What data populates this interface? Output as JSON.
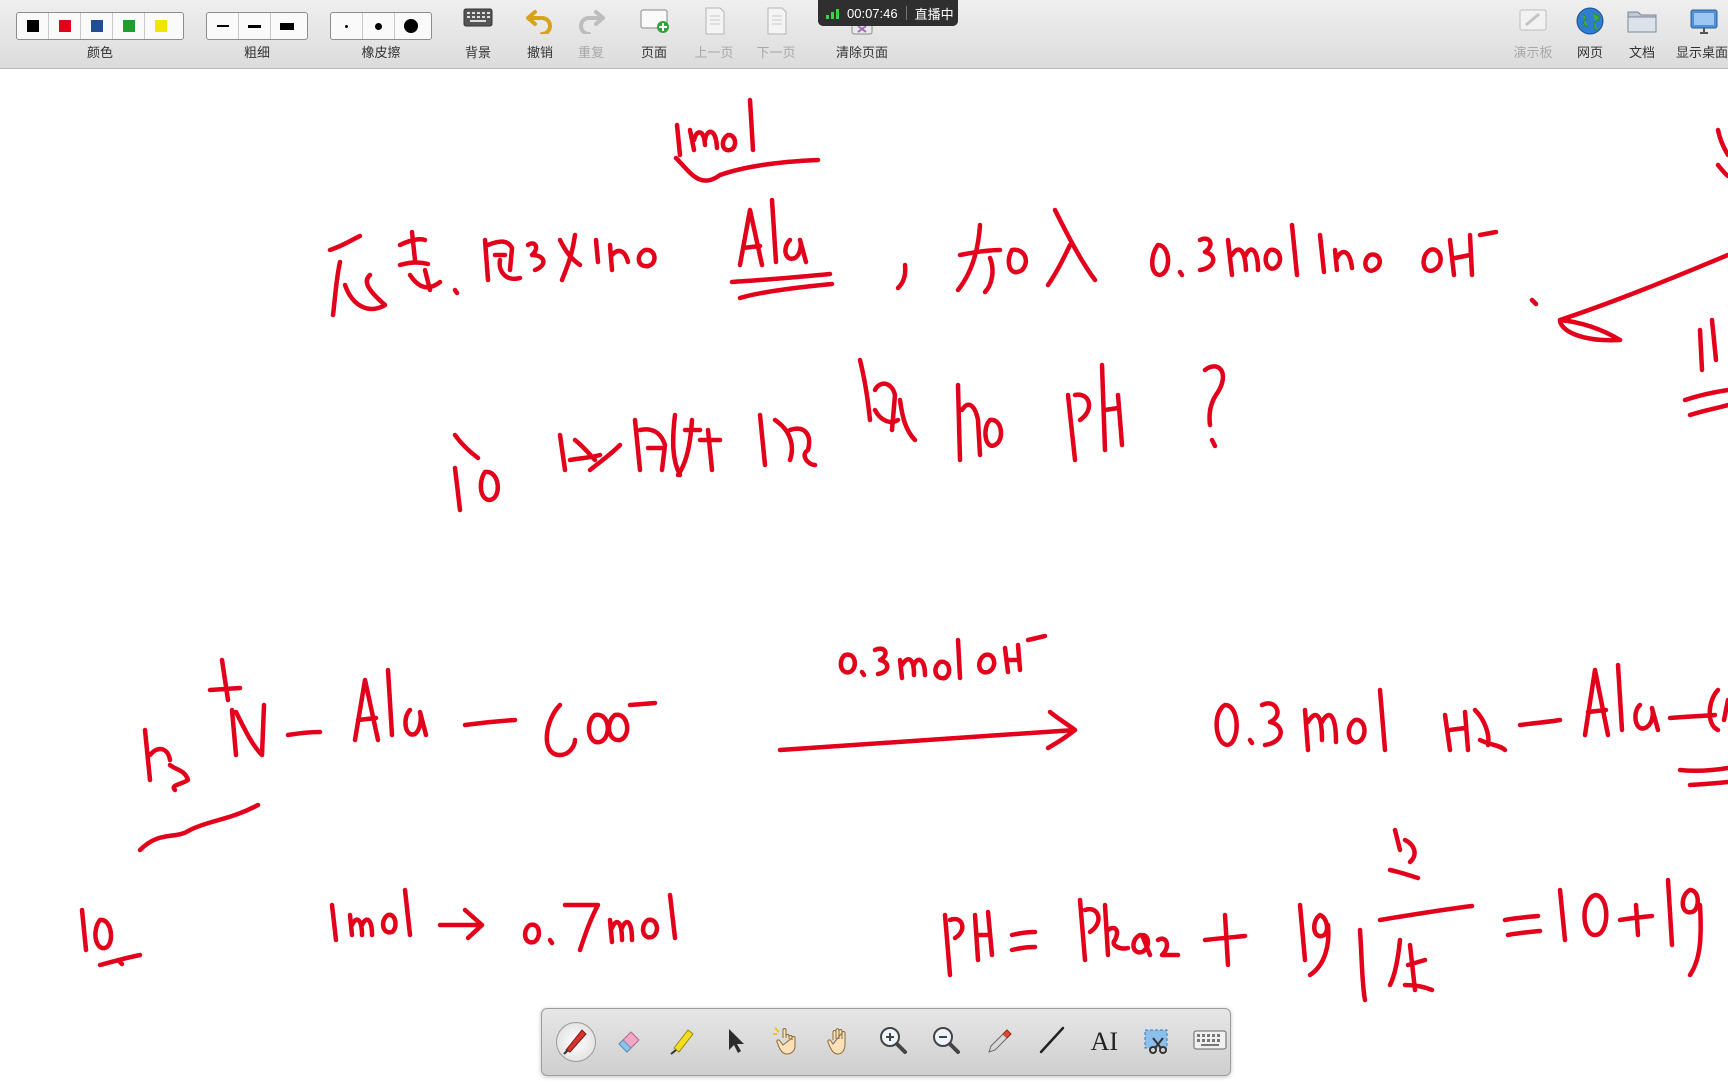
{
  "toolbar": {
    "color_label": "颜色",
    "colors": [
      "#000000",
      "#e3001b",
      "#1f4e96",
      "#1e9e2e",
      "#f2e600"
    ],
    "thickness_label": "粗细",
    "eraser_label": "橡皮擦",
    "background_label": "背景",
    "undo_label": "撤销",
    "redo_label": "重复",
    "page_label": "页面",
    "prev_page_label": "上一页",
    "next_page_label": "下一页",
    "clear_page_label": "清除页面",
    "demo_board_label": "演示板",
    "webpage_label": "网页",
    "document_label": "文档",
    "show_desktop_label": "显示桌面"
  },
  "recording": {
    "time": "00:07:46",
    "status": "直播中"
  },
  "canvas": {
    "ink_color": "#e3001b"
  },
  "palette": {
    "tools": [
      "pen-icon",
      "eraser-icon",
      "highlighter-icon",
      "pointer-icon",
      "laser-hand-icon",
      "pan-hand-icon",
      "zoom-in-icon",
      "zoom-out-icon",
      "eyedropper-icon",
      "line-icon",
      "text-icon",
      "screenshot-icon",
      "keyboard-icon"
    ],
    "text_tool_glyph": "AI"
  }
}
